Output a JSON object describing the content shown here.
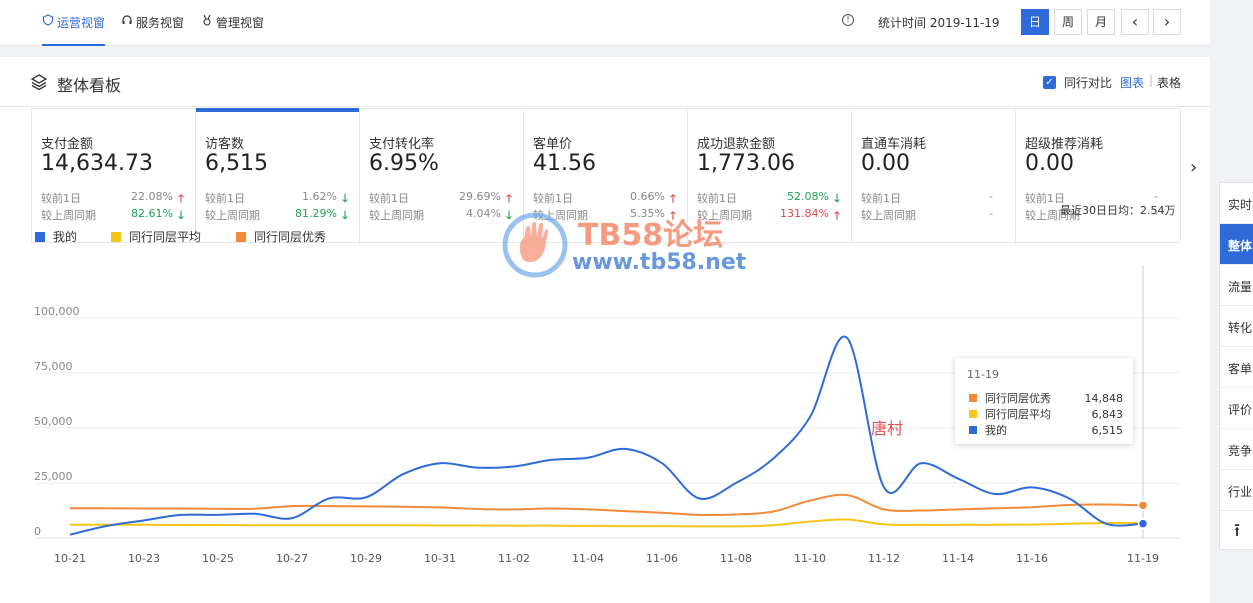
{
  "nav": {
    "tabs": [
      {
        "label": "运营视窗",
        "icon": "shield-icon"
      },
      {
        "label": "服务视窗",
        "icon": "headset-icon"
      },
      {
        "label": "管理视窗",
        "icon": "medal-icon"
      }
    ],
    "stat_time": "统计时间 2019-11-19",
    "periods": [
      "日",
      "周",
      "月"
    ],
    "prev": "‹",
    "next": "›"
  },
  "board": {
    "title": "整体看板",
    "compare_label": "同行对比",
    "view_chart": "图表",
    "view_sep": "|",
    "view_table": "表格"
  },
  "metrics": [
    {
      "title": "支付金额",
      "value": "14,634.73",
      "r1_label": "较前1日",
      "r1_pct": "22.08%",
      "r1_dir": "up",
      "r2_label": "较上周同期",
      "r2_pct": "82.61%",
      "r2_dir": "down"
    },
    {
      "title": "访客数",
      "value": "6,515",
      "r1_label": "较前1日",
      "r1_pct": "1.62%",
      "r1_dir": "down",
      "r2_label": "较上周同期",
      "r2_pct": "81.29%",
      "r2_dir": "down"
    },
    {
      "title": "支付转化率",
      "value": "6.95%",
      "r1_label": "较前1日",
      "r1_pct": "29.69%",
      "r1_dir": "up",
      "r2_label": "较上周同期",
      "r2_pct": "4.04%",
      "r2_dir": "down"
    },
    {
      "title": "客单价",
      "value": "41.56",
      "r1_label": "较前1日",
      "r1_pct": "0.66%",
      "r1_dir": "up",
      "r2_label": "较上周同期",
      "r2_pct": "5.35%",
      "r2_dir": "up"
    },
    {
      "title": "成功退款金额",
      "value": "1,773.06",
      "r1_label": "较前1日",
      "r1_pct": "52.08%",
      "r1_dir": "down",
      "r2_label": "较上周同期",
      "r2_pct": "131.84%",
      "r2_dir": "up"
    },
    {
      "title": "直通车消耗",
      "value": "0.00",
      "r1_label": "较前1日",
      "r1_pct": "-",
      "r1_dir": "",
      "r2_label": "较上周同期",
      "r2_pct": "-",
      "r2_dir": ""
    },
    {
      "title": "超级推荐消耗",
      "value": "0.00",
      "r1_label": "较前1日",
      "r1_pct": "-",
      "r1_dir": "",
      "r2_label": "较上周同期",
      "r2_pct": "-",
      "r2_dir": ""
    }
  ],
  "next_arrow": "›",
  "avg_label": "最近30日日均：2.54万",
  "colors": {
    "accent": "#2f6bd8",
    "mine": "#2f6bd8",
    "avg": "#f5c518",
    "top": "#f28a3a",
    "up": "#e24646",
    "down": "#1fa055"
  },
  "tooltip": {
    "date": "11-19",
    "rows": [
      {
        "name": "同行同层优秀",
        "value": "14,848",
        "color": "#f28a3a"
      },
      {
        "name": "同行同层平均",
        "value": "6,843",
        "color": "#f5c518"
      },
      {
        "name": "我的",
        "value": "6,515",
        "color": "#2f6bd8"
      }
    ]
  },
  "watermark": {
    "title": "TB58论坛",
    "url": "www.tb58.net",
    "stamp": "唐村"
  },
  "sidebar": {
    "items": [
      "实时",
      "整体",
      "流量",
      "转化",
      "客单",
      "评价",
      "竞争",
      "行业"
    ],
    "active": "整体",
    "top": "⭱"
  },
  "chart_data": {
    "type": "line",
    "x": [
      "10-21",
      "10-22",
      "10-23",
      "10-24",
      "10-25",
      "10-26",
      "10-27",
      "10-28",
      "10-29",
      "10-30",
      "10-31",
      "11-01",
      "11-02",
      "11-03",
      "11-04",
      "11-05",
      "11-06",
      "11-07",
      "11-08",
      "11-09",
      "11-10",
      "11-11",
      "11-12",
      "11-13",
      "11-14",
      "11-15",
      "11-16",
      "11-17",
      "11-18",
      "11-19"
    ],
    "x_ticks": [
      "10-21",
      "10-23",
      "10-25",
      "10-27",
      "10-29",
      "10-31",
      "11-02",
      "11-04",
      "11-06",
      "11-08",
      "11-10",
      "11-12",
      "11-14",
      "11-16",
      "11-19"
    ],
    "y_ticks": [
      "0",
      "25,000",
      "50,000",
      "75,000",
      "100,000"
    ],
    "ylim": [
      0,
      100000
    ],
    "grid": true,
    "legend_position": "top-left",
    "series": [
      {
        "name": "我的",
        "color": "#2f6bd8",
        "values": [
          1500,
          5500,
          8000,
          10500,
          10500,
          11000,
          9000,
          18000,
          18500,
          29000,
          34000,
          32000,
          32500,
          35500,
          36500,
          40500,
          34000,
          18000,
          25000,
          36000,
          55000,
          91000,
          23000,
          34000,
          27000,
          20000,
          23000,
          18000,
          6500,
          6515
        ]
      },
      {
        "name": "同行同层平均",
        "color": "#f5c518",
        "values": [
          6000,
          6000,
          6000,
          5900,
          5900,
          5800,
          5800,
          5800,
          5800,
          5800,
          5700,
          5700,
          5600,
          5600,
          5500,
          5400,
          5400,
          5300,
          5300,
          5800,
          7500,
          8400,
          6200,
          6000,
          6000,
          6000,
          6100,
          6500,
          6800,
          6843
        ]
      },
      {
        "name": "同行同层优秀",
        "color": "#f28a3a",
        "values": [
          13500,
          13500,
          13400,
          13400,
          13300,
          13300,
          14500,
          14500,
          14400,
          14200,
          13900,
          13200,
          13000,
          13400,
          13000,
          12200,
          11500,
          10500,
          10700,
          12000,
          17000,
          19500,
          13000,
          12500,
          13000,
          13500,
          14000,
          15000,
          15200,
          14848
        ]
      }
    ]
  }
}
